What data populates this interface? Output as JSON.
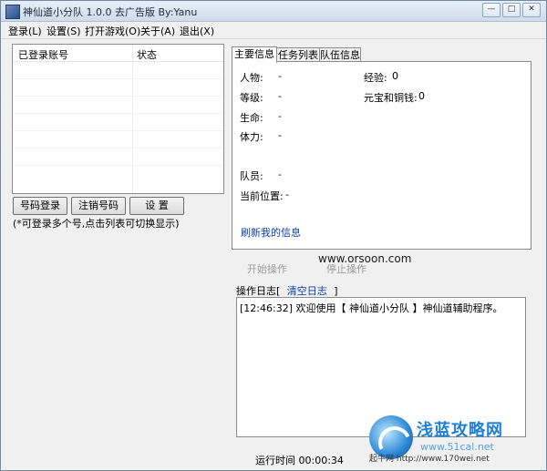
{
  "window": {
    "title": "神仙道小分队 1.0.0 去广告版 By:Yanu",
    "controls": [
      "—",
      "□",
      "✕"
    ]
  },
  "menu": [
    "登录(L)",
    "设置(S)",
    "打开游戏(O)",
    "关于(A)",
    "退出(X)"
  ],
  "accounts": {
    "columns": [
      "已登录账号",
      "状态"
    ],
    "rows": []
  },
  "buttons": {
    "login": "号码登录",
    "logout": "注销号码",
    "settings": "设  置"
  },
  "hint": "(*可登录多个号,点击列表可切换显示)",
  "tabs": [
    "主要信息",
    "任务列表",
    "队伍信息"
  ],
  "info": {
    "character_label": "人物:",
    "character_value": "-",
    "level_label": "等级:",
    "level_value": "-",
    "hp_label": "生命:",
    "hp_value": "-",
    "stamina_label": "体力:",
    "stamina_value": "-",
    "members_label": "队员:",
    "members_value": "-",
    "location_label": "当前位置:",
    "location_value": "-",
    "exp_label": "经验:",
    "exp_value": "0",
    "money_label": "元宝和铜钱:",
    "money_value": "0",
    "refresh_link": "刷新我的信息"
  },
  "operations": {
    "start": "开始操作",
    "stop": "停止操作"
  },
  "watermark": "www.orsoon.com",
  "log": {
    "label": "操作日志[",
    "clear": "清空日志",
    "close_bracket": "]",
    "lines": [
      "[12:46:32] 欢迎使用【 神仙道小分队 】神仙道辅助程序。"
    ]
  },
  "status": {
    "runtime": "运行时间 00:00:34"
  },
  "site_logo": {
    "title": "浅蓝攻略网",
    "sub": "www.51cal.net",
    "tag": "起牛网 http://www.170wei.net"
  }
}
